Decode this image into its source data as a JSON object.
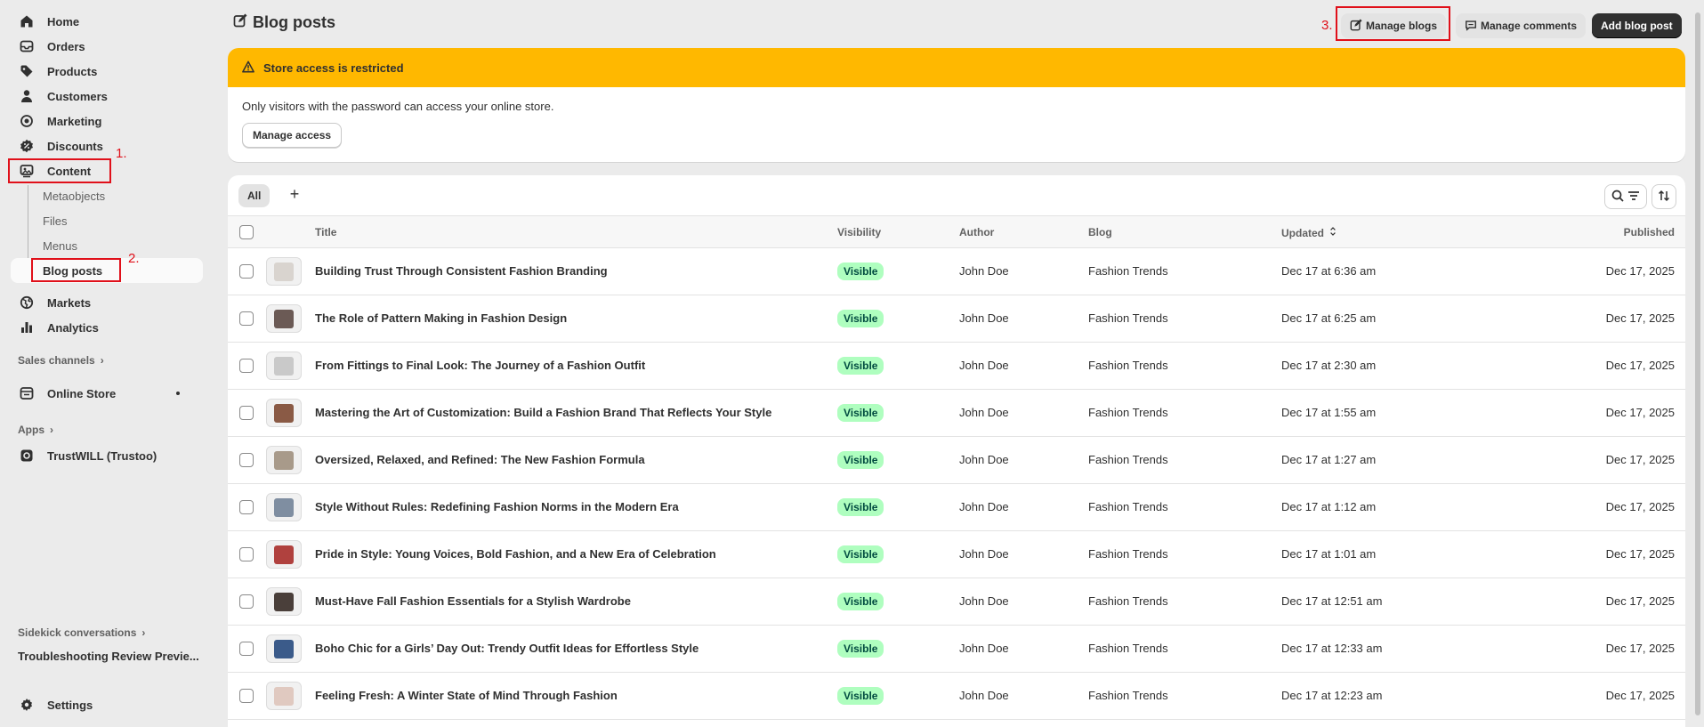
{
  "sidebar": {
    "items": [
      {
        "label": "Home",
        "icon": "home-icon"
      },
      {
        "label": "Orders",
        "icon": "orders-icon"
      },
      {
        "label": "Products",
        "icon": "tag-icon"
      },
      {
        "label": "Customers",
        "icon": "person-icon"
      },
      {
        "label": "Marketing",
        "icon": "target-icon"
      },
      {
        "label": "Discounts",
        "icon": "discount-icon"
      },
      {
        "label": "Content",
        "icon": "content-icon"
      }
    ],
    "content_subitems": [
      "Metaobjects",
      "Files",
      "Menus",
      "Blog posts"
    ],
    "items_after": [
      {
        "label": "Markets",
        "icon": "globe-icon"
      },
      {
        "label": "Analytics",
        "icon": "chart-icon"
      }
    ],
    "sales_channels_label": "Sales channels",
    "online_store_label": "Online Store",
    "apps_label": "Apps",
    "app_item_label": "TrustWILL (Trustoo)",
    "sidekick_label": "Sidekick conversations",
    "sidekick_item": "Troubleshooting Review Previe...",
    "settings_label": "Settings"
  },
  "annotations": [
    "1.",
    "2.",
    "3."
  ],
  "header": {
    "title": "Blog posts",
    "manage_blogs": "Manage blogs",
    "manage_comments": "Manage comments",
    "add_post": "Add blog post"
  },
  "banner": {
    "title": "Store access is restricted",
    "text": "Only visitors with the password can access your online store.",
    "button": "Manage access",
    "color": "#ffb800"
  },
  "table": {
    "tab_all": "All",
    "tab_add": "+",
    "columns": {
      "title": "Title",
      "visibility": "Visibility",
      "author": "Author",
      "blog": "Blog",
      "updated": "Updated",
      "published": "Published"
    },
    "rows": [
      {
        "title": "Building Trust Through Consistent Fashion Branding",
        "visibility": "Visible",
        "author": "John Doe",
        "blog": "Fashion Trends",
        "updated": "Dec 17 at 6:36 am",
        "published": "Dec 17, 2025"
      },
      {
        "title": "The Role of Pattern Making in Fashion Design",
        "visibility": "Visible",
        "author": "John Doe",
        "blog": "Fashion Trends",
        "updated": "Dec 17 at 6:25 am",
        "published": "Dec 17, 2025"
      },
      {
        "title": "From Fittings to Final Look: The Journey of a Fashion Outfit",
        "visibility": "Visible",
        "author": "John Doe",
        "blog": "Fashion Trends",
        "updated": "Dec 17 at 2:30 am",
        "published": "Dec 17, 2025"
      },
      {
        "title": "Mastering the Art of Customization: Build a Fashion Brand That Reflects Your Style",
        "visibility": "Visible",
        "author": "John Doe",
        "blog": "Fashion Trends",
        "updated": "Dec 17 at 1:55 am",
        "published": "Dec 17, 2025"
      },
      {
        "title": "Oversized, Relaxed, and Refined: The New Fashion Formula",
        "visibility": "Visible",
        "author": "John Doe",
        "blog": "Fashion Trends",
        "updated": "Dec 17 at 1:27 am",
        "published": "Dec 17, 2025"
      },
      {
        "title": "Style Without Rules: Redefining Fashion Norms in the Modern Era",
        "visibility": "Visible",
        "author": "John Doe",
        "blog": "Fashion Trends",
        "updated": "Dec 17 at 1:12 am",
        "published": "Dec 17, 2025"
      },
      {
        "title": "Pride in Style: Young Voices, Bold Fashion, and a New Era of Celebration",
        "visibility": "Visible",
        "author": "John Doe",
        "blog": "Fashion Trends",
        "updated": "Dec 17 at 1:01 am",
        "published": "Dec 17, 2025"
      },
      {
        "title": "Must-Have Fall Fashion Essentials for a Stylish Wardrobe",
        "visibility": "Visible",
        "author": "John Doe",
        "blog": "Fashion Trends",
        "updated": "Dec 17 at 12:51 am",
        "published": "Dec 17, 2025"
      },
      {
        "title": "Boho Chic for a Girls’ Day Out: Trendy Outfit Ideas for Effortless Style",
        "visibility": "Visible",
        "author": "John Doe",
        "blog": "Fashion Trends",
        "updated": "Dec 17 at 12:33 am",
        "published": "Dec 17, 2025"
      },
      {
        "title": "Feeling Fresh: A Winter State of Mind Through Fashion",
        "visibility": "Visible",
        "author": "John Doe",
        "blog": "Fashion Trends",
        "updated": "Dec 17 at 12:23 am",
        "published": "Dec 17, 2025"
      }
    ],
    "thumb_colors": [
      "#d9d4cf",
      "#6b5a55",
      "#c9c9c9",
      "#8a5a45",
      "#a89a8a",
      "#7f8ea1",
      "#b0413e",
      "#4a3f3a",
      "#3b5b8a",
      "#e0c9c0"
    ]
  }
}
